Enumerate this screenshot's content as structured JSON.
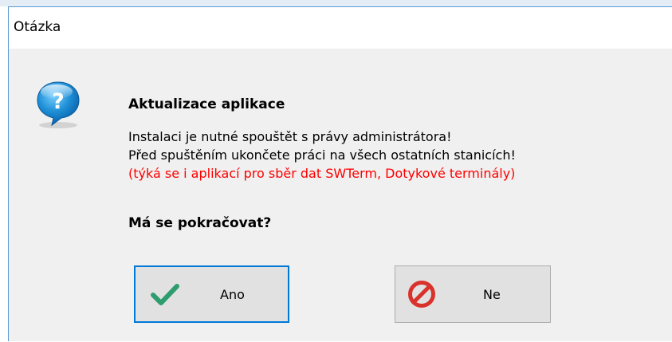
{
  "window": {
    "title": "Otázka"
  },
  "message": {
    "heading": "Aktualizace aplikace",
    "line1": "Instalaci je nutné spouštět s právy administrátora!",
    "line2": "Před spuštěním ukončete práci na všech ostatních stanicích!",
    "line3_warning": "(týká se i aplikací pro sběr dat SWTerm, Dotykové terminály)",
    "prompt": "Má se pokračovat?"
  },
  "icons": {
    "dialog": "question-bubble-icon",
    "yes": "checkmark-icon",
    "no": "prohibited-icon"
  },
  "buttons": {
    "yes_label": "Ano",
    "no_label": "Ne"
  },
  "colors": {
    "warning_text": "#ff0000",
    "focus_border": "#0078d7",
    "check_green": "#2e9d6e",
    "prohibit_red": "#d9322c",
    "bubble_blue": "#1e8fd6"
  }
}
